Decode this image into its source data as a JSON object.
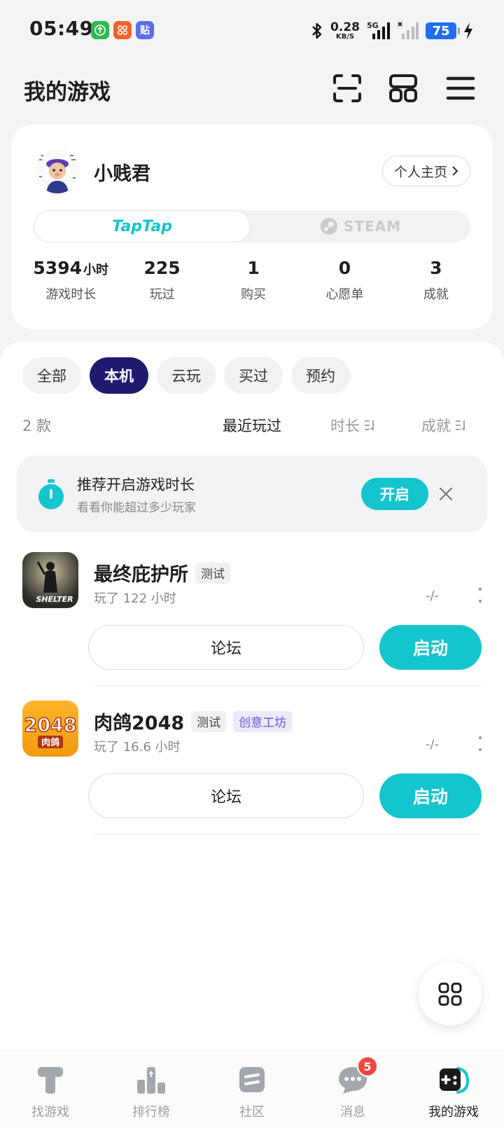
{
  "status_bar": {
    "time": "05:49",
    "net_speed": "0.28",
    "net_unit": "KB/S",
    "signal_label": "5G",
    "battery": "75",
    "apps": [
      {
        "icon": "arrow-up-app-icon",
        "color": "#2dbb4e"
      },
      {
        "icon": "grid-app-icon",
        "color": "#f2622b"
      },
      {
        "icon": "tieba-app-icon",
        "color": "#5b6ee8",
        "glyph": "贴"
      }
    ]
  },
  "header": {
    "title": "我的游戏",
    "icons": [
      "scan-icon",
      "layout-icon",
      "menu-icon"
    ]
  },
  "profile": {
    "username": "小贱君",
    "homepage_label": "个人主页",
    "platforms": {
      "taptap": "TapTap",
      "steam": "STEAM",
      "active": "taptap"
    },
    "stats": [
      {
        "value": "5394",
        "unit": "小时",
        "label": "游戏时长"
      },
      {
        "value": "225",
        "unit": "",
        "label": "玩过"
      },
      {
        "value": "1",
        "unit": "",
        "label": "购买"
      },
      {
        "value": "0",
        "unit": "",
        "label": "心愿单"
      },
      {
        "value": "3",
        "unit": "",
        "label": "成就"
      }
    ]
  },
  "filters": {
    "chips": [
      "全部",
      "本机",
      "云玩",
      "买过",
      "预约"
    ],
    "active": "本机",
    "count": "2 款",
    "sorts": [
      "最近玩过",
      "时长",
      "成就"
    ],
    "active_sort": "最近玩过"
  },
  "banner": {
    "title": "推荐开启游戏时长",
    "subtitle": "看看你能超过多少玩家",
    "button": "开启"
  },
  "games": [
    {
      "title": "最终庇护所",
      "tags": [
        {
          "text": "测试",
          "style": "gray"
        }
      ],
      "playtime": "玩了 122 小时",
      "score": "-/-",
      "icon_text": "SHELTER",
      "forum_label": "论坛",
      "launch_label": "启动"
    },
    {
      "title": "肉鸽2048",
      "tags": [
        {
          "text": "测试",
          "style": "gray"
        },
        {
          "text": "创意工坊",
          "style": "purple"
        }
      ],
      "playtime": "玩了 16.6 小时",
      "score": "-/-",
      "icon_text": "2048",
      "icon_subtext": "肉鸽",
      "forum_label": "论坛",
      "launch_label": "启动"
    }
  ],
  "bottom_nav": {
    "items": [
      {
        "label": "找游戏",
        "icon": "find-game-icon"
      },
      {
        "label": "排行榜",
        "icon": "ranking-icon"
      },
      {
        "label": "社区",
        "icon": "community-icon"
      },
      {
        "label": "消息",
        "icon": "message-icon",
        "badge": "5"
      },
      {
        "label": "我的游戏",
        "icon": "my-games-icon"
      }
    ],
    "active": "我的游戏"
  },
  "colors": {
    "accent": "#15c5ce",
    "active_chip": "#1e1b6e",
    "badge": "#f0473f",
    "tag_purple": "#6a55d8"
  }
}
